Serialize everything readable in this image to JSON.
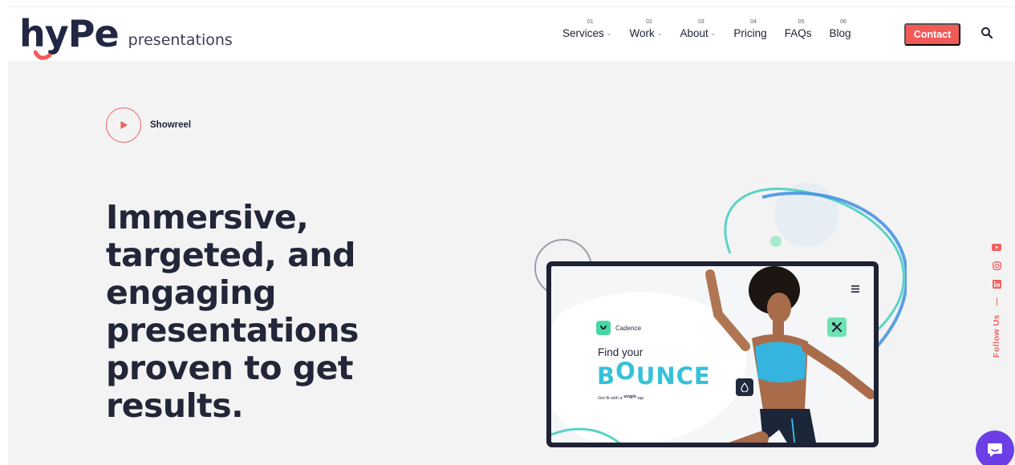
{
  "brand": {
    "logo_mark": "hyPe",
    "logo_word": "presentations",
    "accent": "#f25a58",
    "dark": "#222638"
  },
  "nav": {
    "items": [
      {
        "num": "01",
        "label": "Services",
        "has_dropdown": true
      },
      {
        "num": "02",
        "label": "Work",
        "has_dropdown": true
      },
      {
        "num": "03",
        "label": "About",
        "has_dropdown": true
      },
      {
        "num": "04",
        "label": "Pricing",
        "has_dropdown": false
      },
      {
        "num": "05",
        "label": "FAQs",
        "has_dropdown": false
      },
      {
        "num": "06",
        "label": "Blog",
        "has_dropdown": false
      }
    ],
    "caret": "⌄",
    "contact_label": "Contact",
    "search_icon": "search-icon"
  },
  "hero": {
    "showreel_label": "Showreel",
    "headline_lines": [
      "Immersive,",
      "targeted, and",
      "engaging",
      "presentations",
      "proven to get",
      "results."
    ]
  },
  "mockup": {
    "brand_name": "Cadence",
    "find_text": "Find your",
    "bounce_b": "B",
    "bounce_o": "O",
    "bounce_rest": "UNCE",
    "tagline_pre": "Get fit with a",
    "tagline_em": "single",
    "tagline_post": "tap",
    "bounce_color": "#35c2d8",
    "badge_color": "#6ee3b1"
  },
  "social": {
    "icons": [
      "youtube-icon",
      "instagram-icon",
      "linkedin-icon"
    ],
    "follow_label": "Follow Us"
  },
  "chat": {
    "icon": "chat-bubble-icon",
    "color": "#6b3ee6"
  }
}
